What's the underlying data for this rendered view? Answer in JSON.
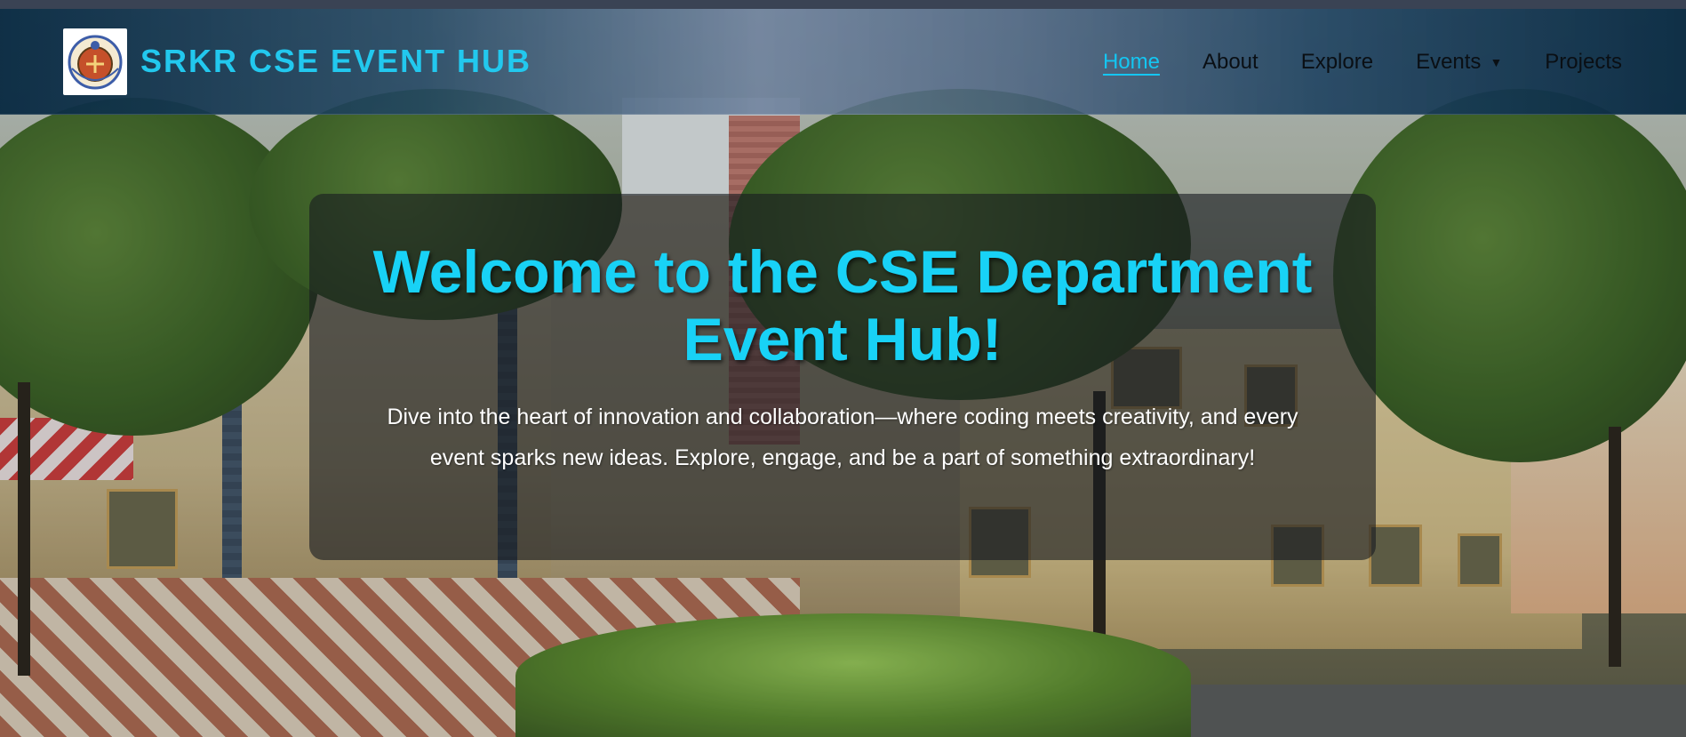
{
  "brand": {
    "name": "SRKR CSE EVENT HUB",
    "logo_icon": "college-emblem-icon"
  },
  "nav": {
    "items": [
      {
        "label": "Home",
        "active": true
      },
      {
        "label": "About",
        "active": false
      },
      {
        "label": "Explore",
        "active": false
      },
      {
        "label": "Events",
        "active": false,
        "has_dropdown": true,
        "caret": "▼"
      },
      {
        "label": "Projects",
        "active": false
      }
    ]
  },
  "hero": {
    "title": "Welcome to the CSE Department Event Hub!",
    "description": "Dive into the heart of innovation and collaboration—where coding meets creativity, and every event sparks new ideas. Explore, engage, and be a part of something extraordinary!"
  },
  "colors": {
    "accent": "#18d2f6",
    "nav_text": "#0a0f14",
    "navbar_bg": "#0b2b44",
    "card_bg": "rgba(24,28,32,0.62)"
  }
}
